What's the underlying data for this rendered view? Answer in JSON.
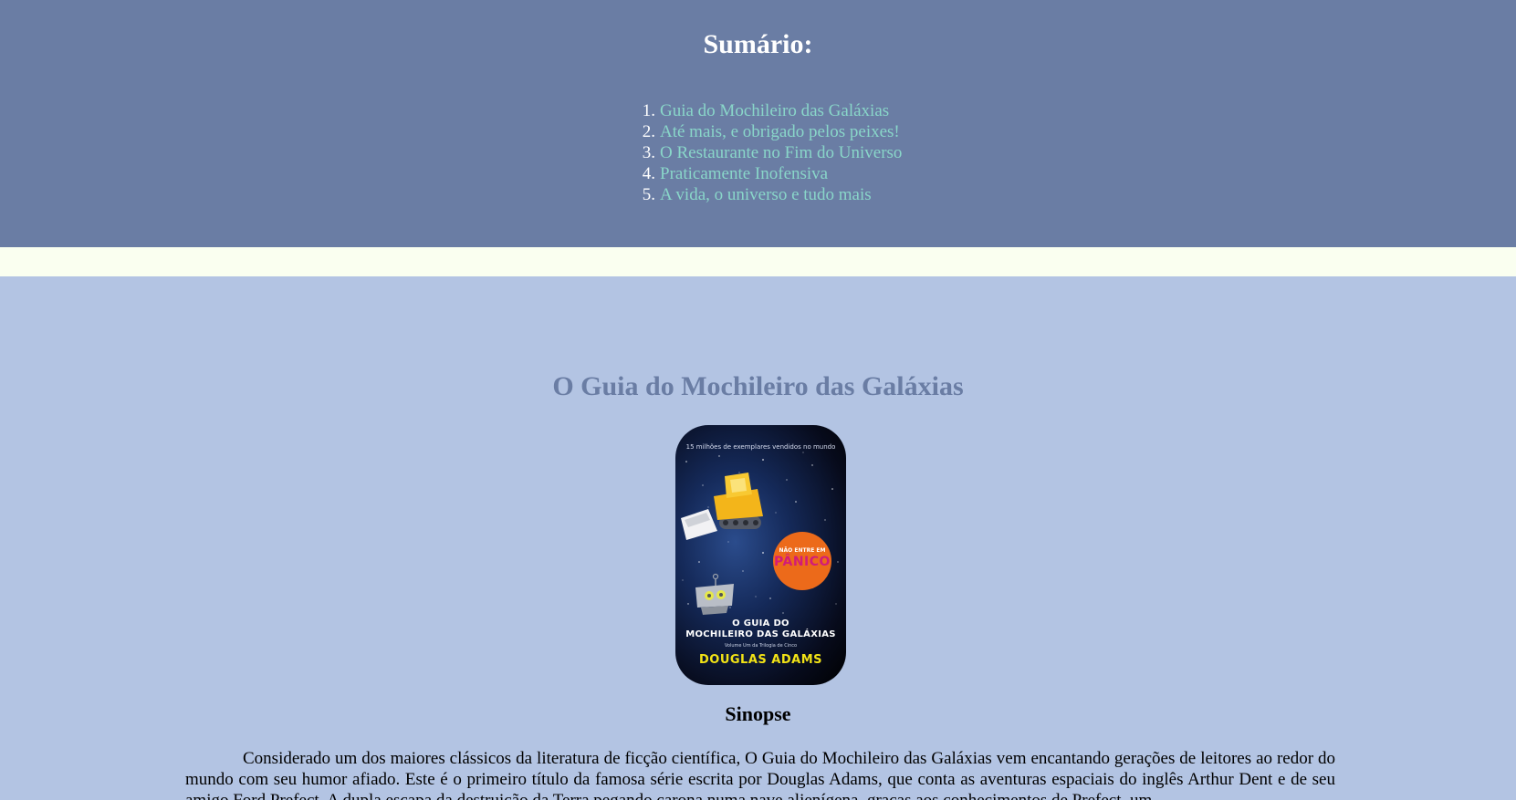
{
  "summary": {
    "title": "Sumário:",
    "items": [
      {
        "number": "1.",
        "label": "Guia do Mochileiro das Galáxias"
      },
      {
        "number": "2.",
        "label": "Até mais, e obrigado pelos peixes!"
      },
      {
        "number": "3.",
        "label": "O Restaurante no Fim do Universo"
      },
      {
        "number": "4.",
        "label": "Praticamente Inofensiva"
      },
      {
        "number": "5.",
        "label": "A vida, o universo e tudo mais"
      }
    ]
  },
  "book": {
    "title": "O Guia do Mochileiro das Galáxias",
    "cover": {
      "tagline": "15 milhões de exemplares vendidos no mundo",
      "badge_top": "NÃO ENTRE EM",
      "badge_main": "PÂNICO",
      "title_line1": "O GUIA DO",
      "title_line2": "MOCHILEIRO DAS GALÁXIAS",
      "subtitle": "Volume Um da Trilogia de Cinco",
      "author": "DOUGLAS ADAMS"
    },
    "synopsis_heading": "Sinopse",
    "synopsis": "Considerado um dos maiores clássicos da literatura de ficção científica, O Guia do Mochileiro das Galáxias vem encantando gerações de leitores ao redor do mundo com seu humor afiado. Este é o primeiro título da famosa série escrita por Douglas Adams, que conta as aventuras espaciais do inglês Arthur Dent e de seu amigo Ford Prefect. A dupla escapa da destruição da Terra pegando carona numa nave alienígena, graças aos conhecimentos de Prefect, um"
  },
  "colors": {
    "summary_bg": "#6a7da4",
    "link": "#89d6c9",
    "divider_band": "#fafff0",
    "content_bg": "#b3c4e3",
    "book_title": "#6a7da4",
    "badge": "#ec6a1a",
    "author_yellow": "#f1e216"
  },
  "icons": [
    "bulldozer-icon",
    "robot-icon",
    "starfield"
  ]
}
